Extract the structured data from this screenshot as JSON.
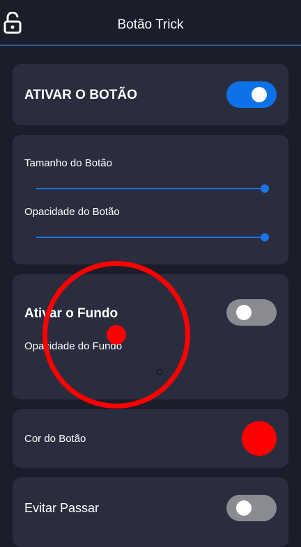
{
  "header": {
    "title": "Botão Trick",
    "lock_icon": "lock-open-icon"
  },
  "activate_card": {
    "label": "ATIVAR O BOTÃO",
    "toggle_on": true
  },
  "size_card": {
    "size_label": "Tamanho do Botão",
    "size_value": 1.0,
    "opacity_label": "Opacidade do Botão",
    "opacity_value": 1.0
  },
  "background_card": {
    "label": "Ativar o Fundo",
    "toggle_on": false,
    "opacity_label": "Opacidade do Fundo",
    "opacity_value": 0.5
  },
  "color_card": {
    "label": "Cor do Botão",
    "color": "#ff0000"
  },
  "avoid_card": {
    "label": "Evitar Passar",
    "toggle_on": false
  },
  "overlay": {
    "color": "#ff0000"
  },
  "colors": {
    "accent": "#0d72e8",
    "background": "#1b1d2a",
    "card": "#2a2d3e"
  }
}
